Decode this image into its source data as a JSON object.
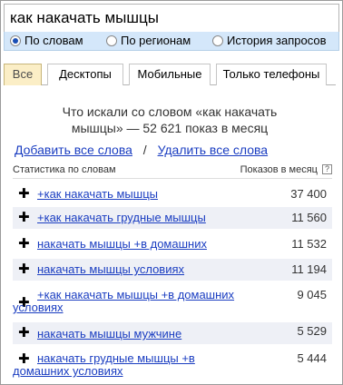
{
  "search": {
    "value": "как накачать мышцы"
  },
  "modes": [
    {
      "label": "По словам",
      "selected": true
    },
    {
      "label": "По регионам",
      "selected": false
    },
    {
      "label": "История запросов",
      "selected": false
    }
  ],
  "tabs": [
    {
      "label": "Все",
      "active": true
    },
    {
      "label": "Десктопы",
      "active": false
    },
    {
      "label": "Мобильные",
      "active": false
    },
    {
      "label": "Только телефоны",
      "active": false
    }
  ],
  "result": {
    "headline_line1": "Что искали со словом «как накачать",
    "headline_line2": "мышцы» — 52 621 показ в месяц",
    "add_all": "Добавить все слова",
    "separator": "/",
    "remove_all": "Удалить все слова"
  },
  "table": {
    "col_left": "Статистика по словам",
    "col_right": "Показов в месяц",
    "help_icon": "?",
    "plus_symbol": "✚",
    "rows": [
      {
        "phrase": "+как накачать мышцы",
        "count": "37 400"
      },
      {
        "phrase": "+как накачать грудные мышцы",
        "count": "11 560"
      },
      {
        "phrase": "накачать мышцы +в домашних",
        "count": "11 532"
      },
      {
        "phrase": "накачать мышцы условиях",
        "count": "11 194"
      },
      {
        "phrase": "+как накачать мышцы +в домашних условиях",
        "count": "9 045"
      },
      {
        "phrase": "накачать мышцы мужчине",
        "count": "5 529"
      },
      {
        "phrase": "накачать грудные мышцы +в домашних условиях",
        "count": "5 444"
      }
    ]
  }
}
